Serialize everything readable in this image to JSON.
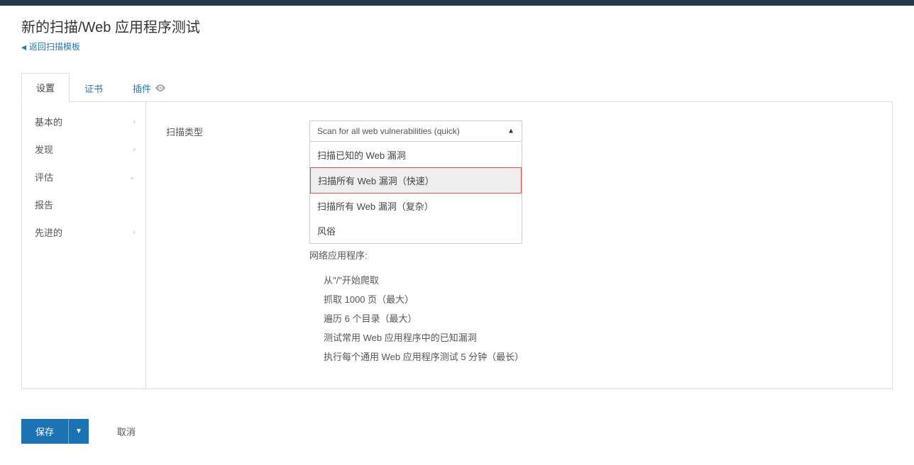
{
  "header": {
    "title": "新的扫描/Web 应用程序测试",
    "back_label": "返回扫描模板"
  },
  "tabs": [
    {
      "label": "设置",
      "active": true
    },
    {
      "label": "证书",
      "active": false
    },
    {
      "label": "插件",
      "active": false,
      "eye": true
    }
  ],
  "sidebar": {
    "items": [
      {
        "label": "基本的",
        "chevron": "right"
      },
      {
        "label": "发现",
        "chevron": "right"
      },
      {
        "label": "评估",
        "chevron": "down"
      },
      {
        "label": "报告"
      },
      {
        "label": "先进的",
        "chevron": "right"
      }
    ]
  },
  "content": {
    "scan_type_label": "扫描类型",
    "scan_type_selected": "Scan for all web vulnerabilities (quick)",
    "dropdown_options": [
      "扫描已知的 Web 漏洞",
      "扫描所有 Web 漏洞（快速）",
      "扫描所有 Web 漏洞（复杂）",
      "风俗"
    ],
    "selected_index": 1,
    "web_app_heading": "网络应用程序:",
    "web_app_items": [
      "从\"/\"开始爬取",
      "抓取 1000 页（最大）",
      "遍历 6 个目录（最大）",
      "测试常用 Web 应用程序中的已知漏洞",
      "执行每个通用 Web 应用程序测试 5 分钟（最长）"
    ]
  },
  "footer": {
    "save_label": "保存",
    "cancel_label": "取消"
  }
}
